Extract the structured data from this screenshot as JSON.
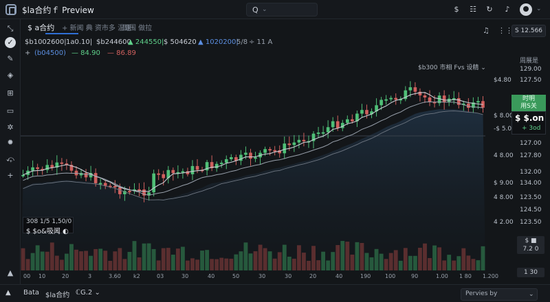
{
  "app": {
    "title": "$la合约ｆ Preview"
  },
  "search": {
    "icon": "Q",
    "chev": "⌄"
  },
  "tabs": [
    {
      "label": "$ a合约",
      "active": true
    },
    {
      "label": "+ 新闻  典 资市多 温速",
      "active": false
    },
    {
      "label": "周围 做拉",
      "active": false
    }
  ],
  "stats": [
    {
      "text": "$b1002600|",
      "color": "#c9ced6"
    },
    {
      "text": "1a0.10|",
      "color": "#c9ced6"
    },
    {
      "text": "$b244600",
      "color": "#c9ced6"
    },
    {
      "text": "▲ 244550|",
      "color": "#5fd08a"
    },
    {
      "text": "$ 504620",
      "color": "#c9ced6"
    },
    {
      "text": "▲ 1020200|",
      "color": "#5b8ee0"
    },
    {
      "text": "5/8",
      "color": "#9aa2ad"
    },
    {
      "text": "÷ 11 A",
      "color": "#9aa2ad"
    }
  ],
  "legend": [
    {
      "text": "+",
      "color": "#aeb5bf"
    },
    {
      "text": "(b04500)",
      "color": "#5b8ee0"
    },
    {
      "text": "— 84.90",
      "color": "#5fd08a"
    },
    {
      "text": "— 86.89",
      "color": "#d0605e"
    }
  ],
  "right_chip": "S 12.566",
  "indicator_dropdown": "$b300 市相 Fvs 设精 ⌄",
  "price_axis": {
    "header": "周展是",
    "ticks": [
      {
        "l": "",
        "r": "129.00",
        "y": 102
      },
      {
        "l": "$4.80",
        "r": "127.50",
        "y": 118
      },
      {
        "l": "",
        "r": "",
        "y": 0
      },
      {
        "l": "$ 8.00",
        "r": "",
        "y": 170
      },
      {
        "l": "-$ 5.00",
        "r": "",
        "y": 189
      },
      {
        "l": "",
        "r": "127.00",
        "y": 210
      },
      {
        "l": "4 8.00",
        "r": "127.80",
        "y": 228
      },
      {
        "l": "",
        "r": "132.00",
        "y": 252
      },
      {
        "l": "$ 9.00",
        "r": "134.00",
        "y": 268
      },
      {
        "l": "4 8.00",
        "r": "123.50",
        "y": 289
      },
      {
        "l": "",
        "r": "124.50",
        "y": 307
      },
      {
        "l": "4 2.00",
        "r": "123.50",
        "y": 325
      }
    ]
  },
  "green_tag": {
    "l1": "时明",
    "l2": "用S关"
  },
  "current_price": {
    "price": "$ $.on",
    "change": "+ 3od"
  },
  "chips_right": [
    {
      "text": "$ ■",
      "y": 344
    },
    {
      "text": "7.2 0",
      "y": 358
    },
    {
      "text": "1 30",
      "y": 392
    }
  ],
  "ohlc_box": {
    "l1": "308  1/5 1,50/0",
    "l2": "$ $o&吸闻  ◐"
  },
  "x_ticks": [
    {
      "t": "00",
      "x": 4
    },
    {
      "t": "10",
      "x": 26
    },
    {
      "t": "20",
      "x": 60
    },
    {
      "t": "3",
      "x": 98
    },
    {
      "t": "3.60",
      "x": 128
    },
    {
      "t": "k2",
      "x": 164
    },
    {
      "t": "03",
      "x": 198
    },
    {
      "t": "30",
      "x": 234
    },
    {
      "t": "40",
      "x": 272
    },
    {
      "t": "50",
      "x": 308
    },
    {
      "t": "30",
      "x": 346
    },
    {
      "t": "30",
      "x": 384
    },
    {
      "t": "20",
      "x": 420
    },
    {
      "t": "40",
      "x": 458
    },
    {
      "t": "190",
      "x": 494
    },
    {
      "t": "100",
      "x": 530
    },
    {
      "t": "90",
      "x": 568
    },
    {
      "t": "1.00",
      "x": 604
    },
    {
      "t": "1 80",
      "x": 638
    },
    {
      "t": "1.200",
      "x": 672
    }
  ],
  "bottom": {
    "a": "Bata",
    "b": "$la合约",
    "c": "ℂG.2 ⌄",
    "preview": "Pervies by",
    "preview_chev": "⌄"
  },
  "colors": {
    "up": "#4fbf77",
    "down": "#d0605e",
    "ma1": "#c8cdd4",
    "ma2": "#9aa2ad"
  }
}
